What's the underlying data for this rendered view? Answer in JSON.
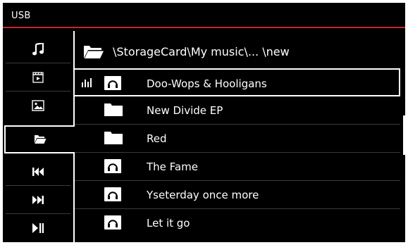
{
  "header": {
    "title": "USB"
  },
  "sidebar": {
    "items": [
      {
        "icon": "music-note-icon"
      },
      {
        "icon": "video-clapper-icon"
      },
      {
        "icon": "picture-icon"
      },
      {
        "icon": "folder-open-icon",
        "active": true
      },
      {
        "icon": "previous-track-icon"
      },
      {
        "icon": "next-track-icon"
      },
      {
        "icon": "play-pause-icon"
      }
    ]
  },
  "browser": {
    "path": "\\StorageCard\\My music\\... \\new",
    "items": [
      {
        "label": "Doo-Wops & Hooligans",
        "type": "audio",
        "playing": true,
        "selected": true
      },
      {
        "label": "New Divide EP",
        "type": "folder"
      },
      {
        "label": "Red",
        "type": "folder"
      },
      {
        "label": "The Fame",
        "type": "audio"
      },
      {
        "label": "Yseterday once more",
        "type": "audio"
      },
      {
        "label": "Let it go",
        "type": "audio"
      }
    ]
  },
  "colors": {
    "accent": "#c8262d",
    "background": "#000000",
    "foreground": "#ffffff"
  }
}
